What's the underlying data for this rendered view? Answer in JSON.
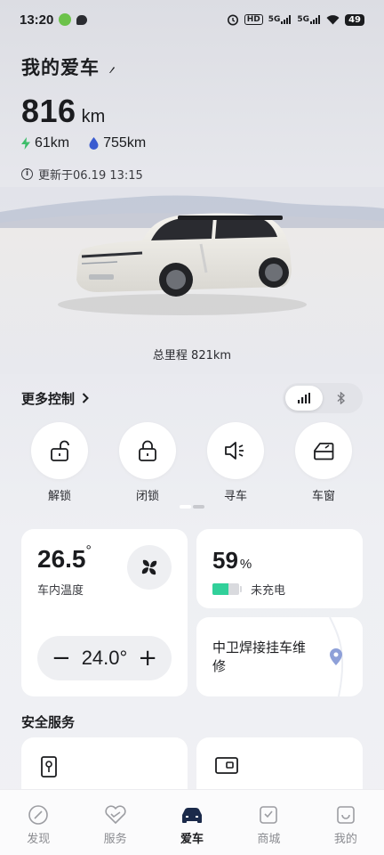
{
  "status": {
    "time": "13:20",
    "battery": "49",
    "net1": "5G",
    "net2": "5G",
    "hd": "HD"
  },
  "header": {
    "title": "我的爱车"
  },
  "range": {
    "total": "816",
    "unit": "km",
    "electric": "61km",
    "fuel": "755km"
  },
  "update": {
    "text": "更新于06.19 13:15"
  },
  "odometer": {
    "label": "总里程 821km"
  },
  "more_controls": {
    "label": "更多控制",
    "chevron": "›",
    "connection_modes": [
      "signal-icon",
      "bluetooth-icon"
    ]
  },
  "controls": [
    {
      "label": "解锁",
      "icon": "unlock-icon"
    },
    {
      "label": "闭锁",
      "icon": "lock-icon"
    },
    {
      "label": "寻车",
      "icon": "horn-icon"
    },
    {
      "label": "车窗",
      "icon": "window-icon"
    }
  ],
  "climate": {
    "temperature": "26.5",
    "degree": "°",
    "label": "车内温度",
    "set_temp": "24.0°",
    "minus": "−",
    "plus": "+"
  },
  "battery": {
    "percent": "59",
    "percent_unit": "%",
    "level": 0.59,
    "status": "未充电",
    "color": "#31d09a"
  },
  "location": {
    "text": "中卫焊接挂车维修"
  },
  "safety": {
    "title": "安全服务"
  },
  "tabs": [
    {
      "label": "发现",
      "icon": "compass-icon",
      "active": false
    },
    {
      "label": "服务",
      "icon": "heart-service-icon",
      "active": false
    },
    {
      "label": "爱车",
      "icon": "car-icon",
      "active": true
    },
    {
      "label": "商城",
      "icon": "shop-icon",
      "active": false
    },
    {
      "label": "我的",
      "icon": "profile-icon",
      "active": false
    }
  ],
  "colors": {
    "accent": "#1b1c1f",
    "electric": "#3dbd6a",
    "fuel": "#3a5bd0",
    "location_pin": "#8ea0d8"
  }
}
